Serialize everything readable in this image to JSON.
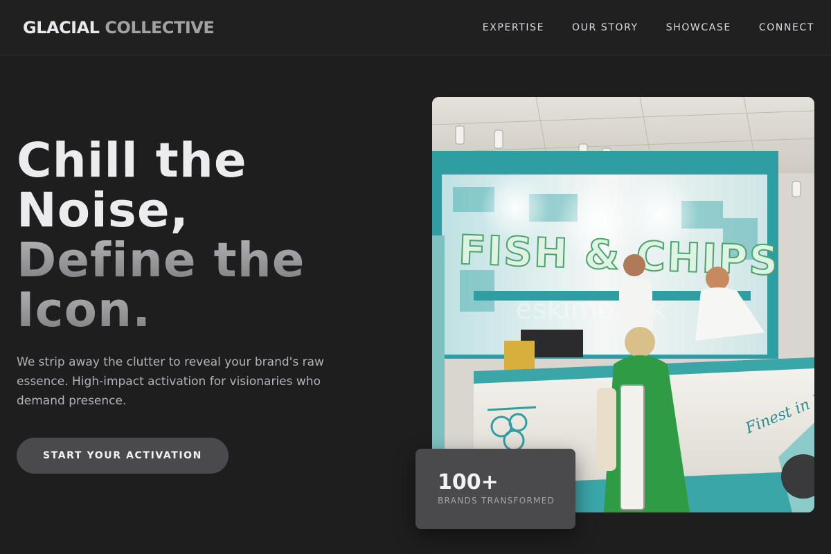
{
  "brand": {
    "part1": "GLACIAL",
    "part2": "COLLECTIVE"
  },
  "nav": {
    "items": [
      {
        "label": "EXPERTISE"
      },
      {
        "label": "OUR STORY"
      },
      {
        "label": "SHOWCASE"
      },
      {
        "label": "CONNECT"
      }
    ]
  },
  "hero": {
    "headline_line1a": "Chill the",
    "headline_line1b": "Noise,",
    "headline_line2a": "Define the",
    "headline_line2b": "Icon.",
    "subtext": "We strip away the clutter to reveal your brand's raw essence. High-impact activation for visionaries who demand presence.",
    "cta_label": "START YOUR ACTIVATION"
  },
  "photo": {
    "sign_text": "FISH & CHIPS",
    "counter_text": "Finest in London",
    "watermark": "eskimo.tok"
  },
  "stat": {
    "value": "100+",
    "label": "BRANDS TRANSFORMED"
  },
  "colors": {
    "background": "#1e1e1f",
    "accent_button": "#4a4a4c",
    "photo_teal": "#3aa6a8"
  }
}
